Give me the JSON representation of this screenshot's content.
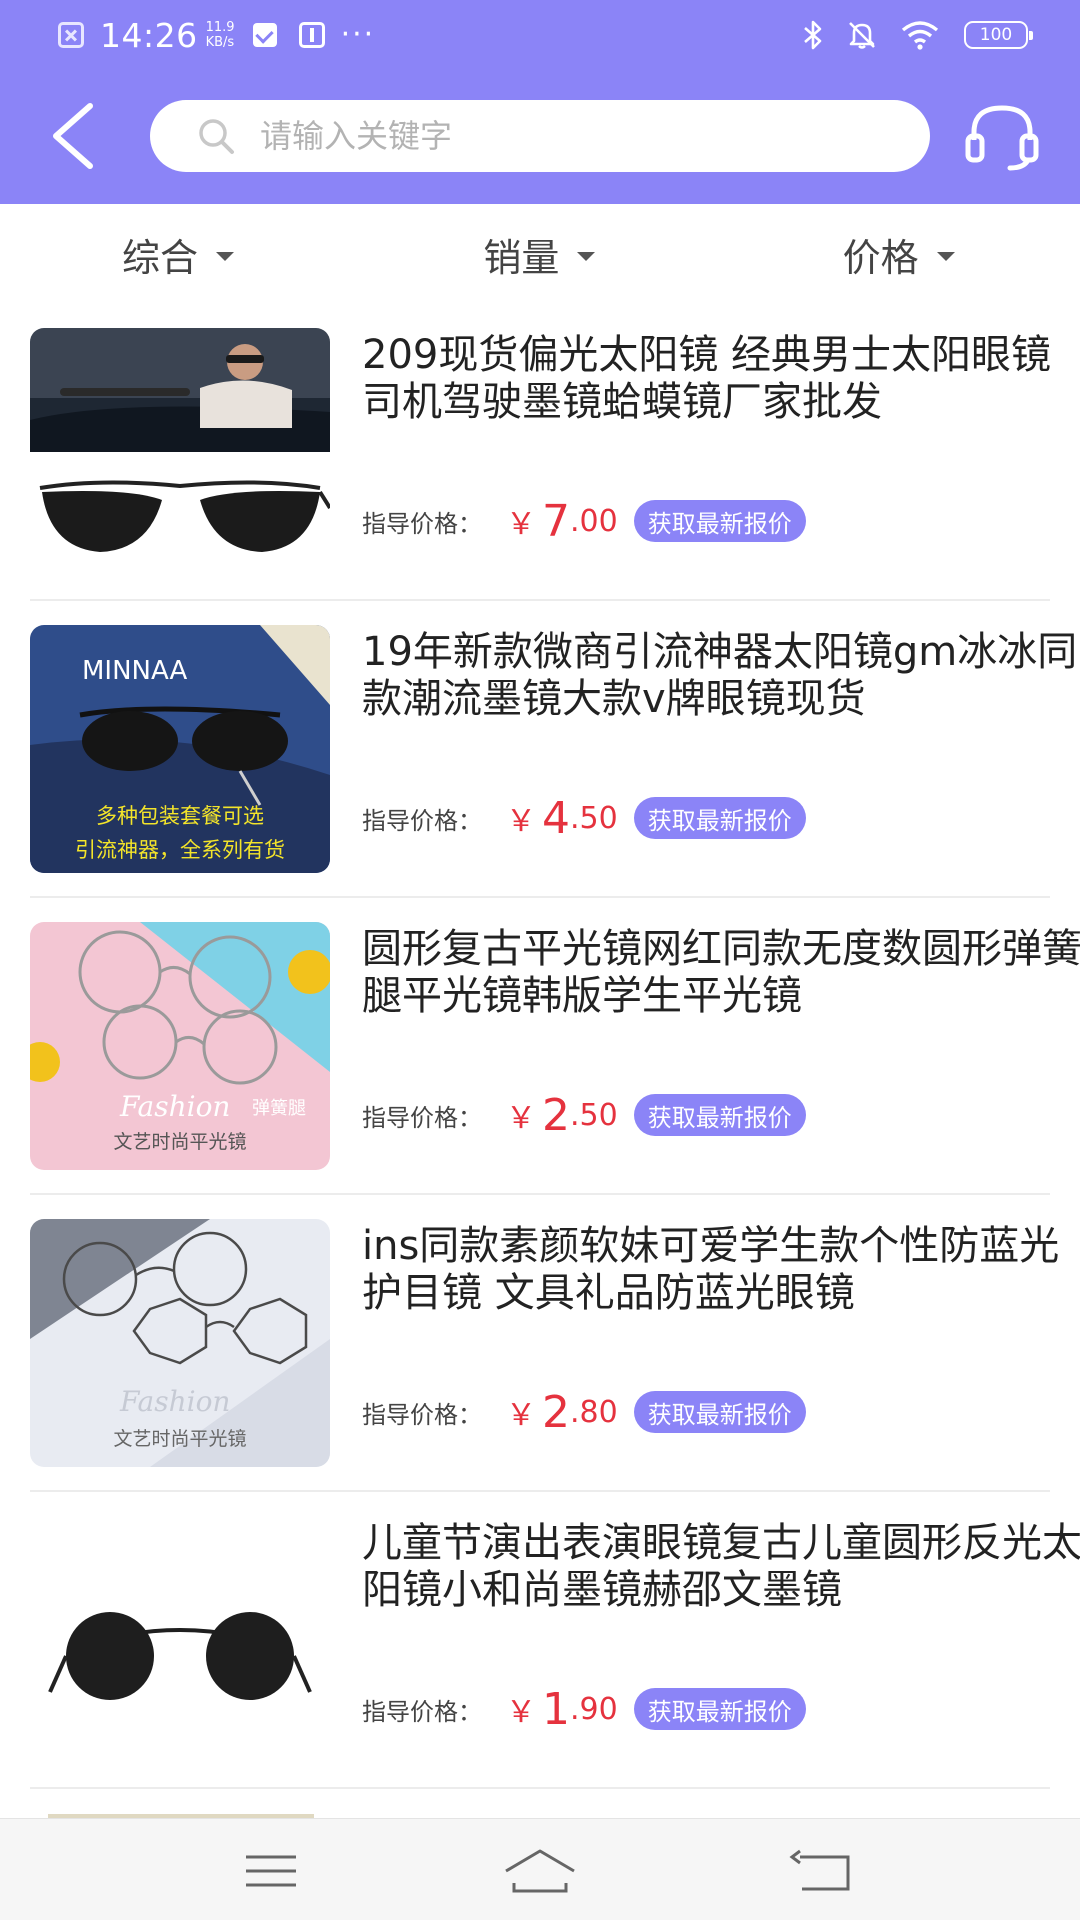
{
  "status_bar": {
    "time": "14:26",
    "net_speed_value": "11.9",
    "net_speed_unit": "KB/s",
    "battery": "100",
    "icons": [
      "close-square-icon",
      "check-square-icon",
      "usb-icon",
      "more-dots-icon",
      "bluetooth-icon",
      "mute-bell-icon",
      "wifi-icon",
      "battery-icon"
    ]
  },
  "header": {
    "back_icon": "chevron-left-icon",
    "search_placeholder": "请输入关键字",
    "search_icon": "search-icon",
    "support_icon": "headset-icon"
  },
  "sort_tabs": [
    {
      "label": "综合"
    },
    {
      "label": "销量"
    },
    {
      "label": "价格"
    }
  ],
  "products": [
    {
      "title": "209现货偏光太阳镜 经典男士太阳眼镜司机驾驶墨镜蛤蟆镜厂家批发",
      "price_label": "指导价格：",
      "currency": "￥",
      "price_int": "7",
      "price_dec": ".00",
      "button": "获取最新报价"
    },
    {
      "title": "19年新款微商引流神器太阳镜gm冰冰同款潮流墨镜大款v牌眼镜现货",
      "price_label": "指导价格：",
      "currency": "￥",
      "price_int": "4",
      "price_dec": ".50",
      "button": "获取最新报价",
      "image_text": [
        "MINNAA",
        "多种包装套餐可选",
        "引流神器，全系列有货"
      ]
    },
    {
      "title": "圆形复古平光镜网红同款无度数圆形弹簧腿平光镜韩版学生平光镜",
      "price_label": "指导价格：",
      "currency": "￥",
      "price_int": "2",
      "price_dec": ".50",
      "button": "获取最新报价",
      "image_text": [
        "Fashion",
        "弹簧腿",
        "文艺时尚平光镜"
      ]
    },
    {
      "title": "ins同款素颜软妹可爱学生款个性防蓝光护目镜 文具礼品防蓝光眼镜",
      "price_label": "指导价格：",
      "currency": "￥",
      "price_int": "2",
      "price_dec": ".80",
      "button": "获取最新报价",
      "image_text": [
        "Fashion",
        "文艺时尚平光镜"
      ]
    },
    {
      "title": "儿童节演出表演眼镜复古儿童圆形反光太阳镜小和尚墨镜赫邵文墨镜",
      "price_label": "指导价格：",
      "currency": "￥",
      "price_int": "1",
      "price_dec": ".90",
      "button": "获取最新报价"
    }
  ],
  "nav_bar": {
    "icons": [
      "menu-icon",
      "home-icon",
      "back-icon"
    ]
  },
  "colors": {
    "accent": "#8b84f7",
    "price": "#e5323e"
  }
}
